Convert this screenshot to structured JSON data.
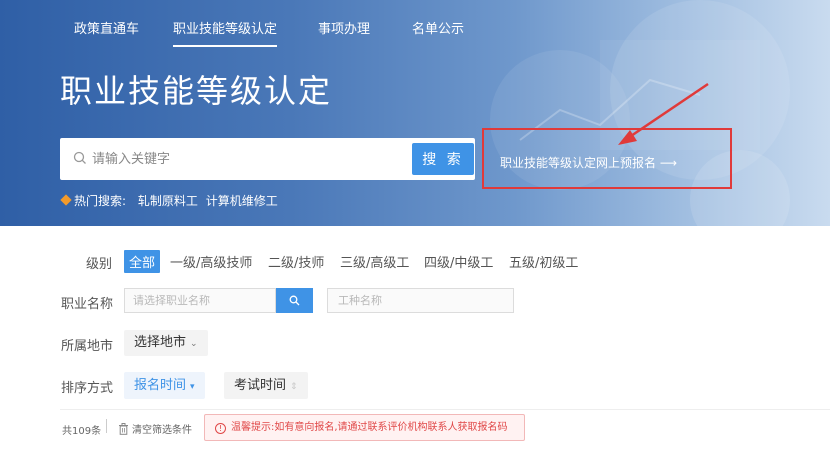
{
  "nav": {
    "items": [
      {
        "label": "政策直通车"
      },
      {
        "label": "职业技能等级认定"
      },
      {
        "label": "事项办理"
      },
      {
        "label": "名单公示"
      }
    ],
    "active_index": 1
  },
  "hero": {
    "title": "职业技能等级认定",
    "search": {
      "placeholder": "请输入关键字",
      "value": "",
      "button_label": "搜 索"
    },
    "prereg_link": "职业技能等级认定网上预报名 ⟶",
    "hot": {
      "label": "热门搜索:",
      "terms": [
        "轧制原料工",
        "计算机维修工"
      ]
    }
  },
  "filters": {
    "level": {
      "label": "级别",
      "options": [
        "全部",
        "一级/高级技师",
        "二级/技师",
        "三级/高级工",
        "四级/中级工",
        "五级/初级工"
      ],
      "selected_index": 0
    },
    "job": {
      "label": "职业名称",
      "job_placeholder": "请选择职业名称",
      "trade_placeholder": "工种名称"
    },
    "city": {
      "label": "所属地市",
      "select_label": "选择地市"
    },
    "sort": {
      "label": "排序方式",
      "options": [
        "报名时间",
        "考试时间"
      ],
      "active_index": 0
    }
  },
  "results": {
    "total": "共109条",
    "clear_label": "清空筛选条件",
    "notice": "温馨提示:如有意向报名,请通过联系评价机构联系人获取报名码"
  },
  "colors": {
    "accent": "#3f93e6",
    "annotation": "#e03a3a",
    "notice_text": "#e04848",
    "hot_icon": "#f39a2b"
  },
  "icons": {
    "search": "search-icon",
    "hot": "flame-icon",
    "clear": "trash-icon",
    "notice": "info-icon",
    "chevron": "chevron-down-icon",
    "sort": "sort-caret-icon"
  }
}
